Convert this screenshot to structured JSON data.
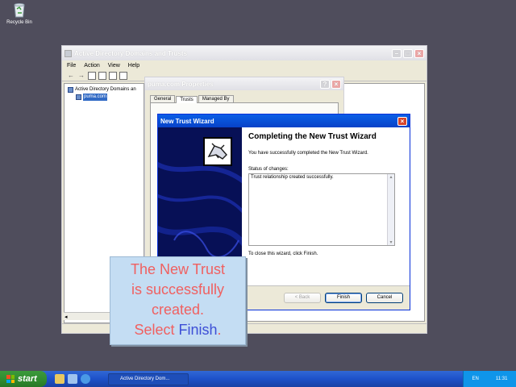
{
  "desktop": {
    "recycle_bin_label": "Recycle Bin"
  },
  "main_window": {
    "title": "Active Directory Domains and Trusts",
    "menu": [
      "File",
      "Action",
      "View",
      "Help"
    ],
    "tree": {
      "root": "Active Directory Domains an",
      "child": "puma.com"
    }
  },
  "properties_dialog": {
    "title": "puma.com Properties",
    "tabs": [
      "General",
      "Trusts",
      "Managed By"
    ],
    "active_tab": "Trusts"
  },
  "wizard": {
    "title": "New Trust Wizard",
    "heading": "Completing the New Trust Wizard",
    "completed_text": "You have successfully completed the New Trust Wizard.",
    "status_label": "Status of changes:",
    "status_text": "Trust relationship created successfully.",
    "close_text": "To close this wizard, click Finish.",
    "buttons": {
      "back": "< Back",
      "finish": "Finish",
      "cancel": "Cancel"
    },
    "colors": {
      "side_panel": "#071056",
      "title_bar": "#0a5fe6"
    }
  },
  "callout": {
    "line1": "The New Trust",
    "line2": "is successfully",
    "line3": "created.",
    "line4_prefix": "Select ",
    "line4_highlight": "Finish",
    "line4_suffix": ".",
    "colors": {
      "text": "#f06060",
      "highlight": "#3d4fd6",
      "background": "#c4ddf3"
    }
  },
  "taskbar": {
    "start_label": "start",
    "task_button": "Active Directory Dom...",
    "language": "EN",
    "time": "11:31"
  }
}
